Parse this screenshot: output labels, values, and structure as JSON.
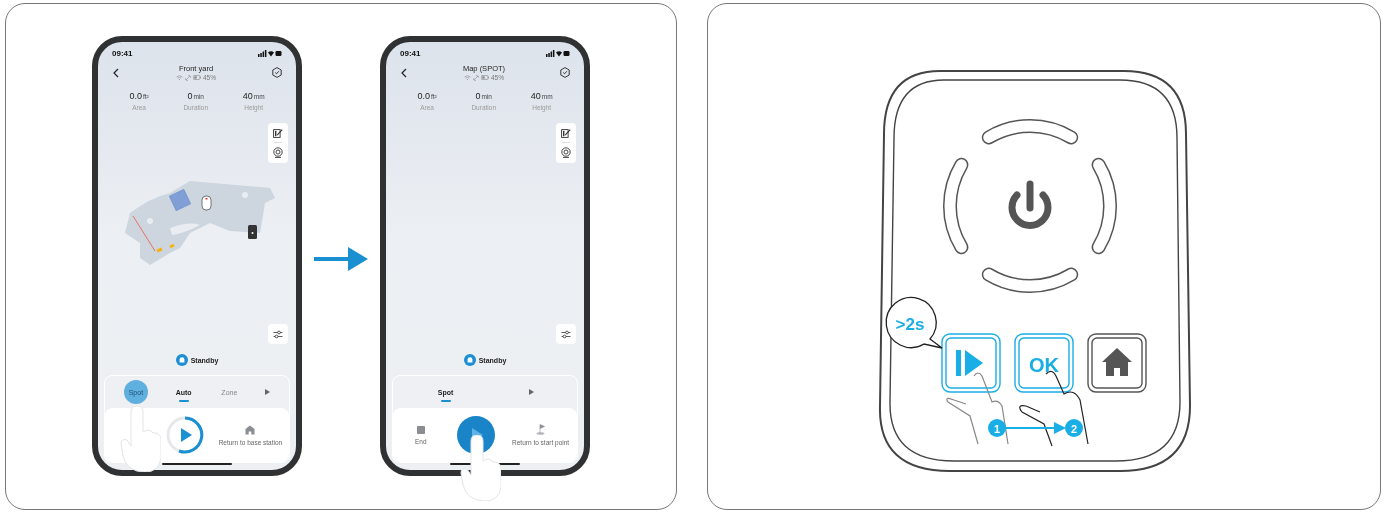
{
  "app_screens": [
    {
      "time": "09:41",
      "title": "Front yard",
      "battery": "45%",
      "stats": [
        {
          "value": "0.0",
          "unit": "ft²",
          "label": "Area"
        },
        {
          "value": "0",
          "unit": "min",
          "label": "Duration"
        },
        {
          "value": "40",
          "unit": "mm",
          "label": "Height"
        }
      ],
      "map_shown": true,
      "status": "Standby",
      "modes": [
        {
          "label": "Spot",
          "selected": false,
          "pressed": true
        },
        {
          "label": "Auto",
          "selected": true,
          "pressed": false
        },
        {
          "label": "Zone",
          "selected": false,
          "pressed": false
        }
      ],
      "actions": [
        {
          "kind": "blank",
          "pressed": false
        },
        {
          "kind": "play-ring",
          "pressed": false
        },
        {
          "kind": "home",
          "label": "Return to base station",
          "pressed": false
        }
      ]
    },
    {
      "time": "09:41",
      "title": "Map (SPOT)",
      "battery": "45%",
      "stats": [
        {
          "value": "0.0",
          "unit": "ft²",
          "label": "Area"
        },
        {
          "value": "0",
          "unit": "min",
          "label": "Duration"
        },
        {
          "value": "40",
          "unit": "mm",
          "label": "Height"
        }
      ],
      "map_shown": false,
      "status": "Standby",
      "modes": [
        {
          "label": "Spot",
          "selected": true,
          "pressed": false
        }
      ],
      "actions": [
        {
          "kind": "stop",
          "label": "End",
          "pressed": false
        },
        {
          "kind": "play-solid",
          "pressed": true
        },
        {
          "kind": "flag",
          "label": "Return to start point",
          "pressed": false
        }
      ]
    }
  ],
  "device": {
    "hold_badge": ">2s",
    "buttons": [
      {
        "kind": "play",
        "highlighted": true
      },
      {
        "kind": "text",
        "label": "OK",
        "highlighted": true
      },
      {
        "kind": "home",
        "highlighted": false
      }
    ],
    "steps": [
      "1",
      "2"
    ]
  }
}
